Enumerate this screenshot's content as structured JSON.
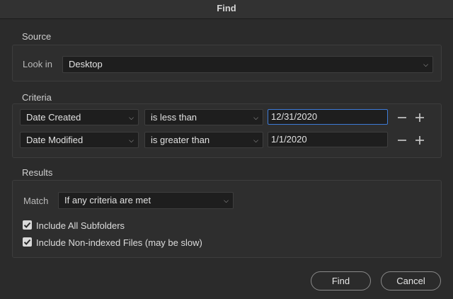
{
  "window": {
    "title": "Find"
  },
  "source": {
    "section_label": "Source",
    "look_in_label": "Look in",
    "look_in_value": "Desktop"
  },
  "criteria": {
    "section_label": "Criteria",
    "rows": [
      {
        "field": "Date Created",
        "operator": "is less than",
        "value": "12/31/2020"
      },
      {
        "field": "Date Modified",
        "operator": "is greater than",
        "value": "1/1/2020"
      }
    ]
  },
  "results": {
    "section_label": "Results",
    "match_label": "Match",
    "match_value": "If any criteria are met",
    "checkboxes": [
      {
        "label": "Include All Subfolders",
        "checked": true
      },
      {
        "label": "Include Non-indexed Files (may be slow)",
        "checked": true
      }
    ]
  },
  "buttons": {
    "find": "Find",
    "cancel": "Cancel"
  },
  "colors": {
    "focus_border": "#3d7bd6",
    "background": "#2b2b2b"
  },
  "icons": [
    "chevron-down-icon",
    "minus-icon",
    "plus-icon",
    "checkmark-icon"
  ]
}
